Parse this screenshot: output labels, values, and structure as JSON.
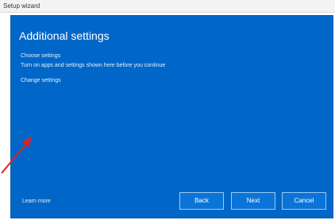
{
  "window": {
    "title": "Setup wizard"
  },
  "dialog": {
    "heading": "Additional settings",
    "lines": [
      "Choose settings",
      "Turn on apps and settings shown here before you continue",
      "Change settings"
    ],
    "link": "Learn more"
  },
  "buttons": {
    "back": "Back",
    "next": "Next",
    "cancel": "Cancel"
  },
  "colors": {
    "panel": "#0067c8",
    "button": "#0a74d8",
    "arrow": "#e02020"
  },
  "icons": {
    "pointer": "red-arrow-icon"
  }
}
